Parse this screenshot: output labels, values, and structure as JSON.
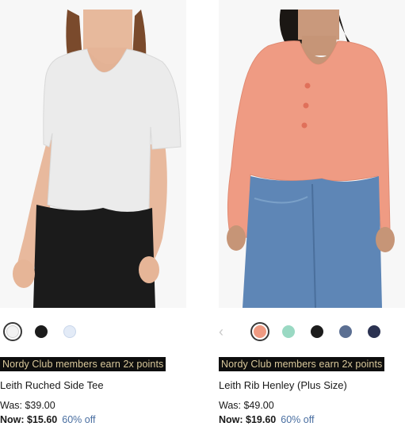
{
  "products": [
    {
      "image_alt": "Woman wearing white V-neck ruched side tee with black skirt",
      "swatches": [
        {
          "name": "White",
          "color": "#f2f2f2",
          "selected": true
        },
        {
          "name": "Black",
          "color": "#1c1c1c",
          "selected": false
        },
        {
          "name": "Light Blue",
          "color": "#e3ebf7",
          "selected": false
        }
      ],
      "badge": "Nordy Club members earn 2x points",
      "name": "Leith Ruched Side Tee",
      "was_label": "Was: $39.00",
      "now_label": "Now: $15.60",
      "discount": "60% off"
    },
    {
      "image_alt": "Woman wearing coral rib henley sweater with blue jeans",
      "has_prev_arrow": true,
      "prev_arrow_icon": "chevron-left-icon",
      "swatches": [
        {
          "name": "Coral",
          "color": "#ef9a82",
          "selected": true
        },
        {
          "name": "Mint",
          "color": "#9ad9c3",
          "selected": false
        },
        {
          "name": "Black",
          "color": "#1c1c1c",
          "selected": false
        },
        {
          "name": "Slate Blue",
          "color": "#5b6f92",
          "selected": false
        },
        {
          "name": "Navy",
          "color": "#2b3251",
          "selected": false
        }
      ],
      "badge": "Nordy Club members earn 2x points",
      "name": "Leith Rib Henley (Plus Size)",
      "was_label": "Was: $49.00",
      "now_label": "Now: $19.60",
      "discount": "60% off"
    }
  ],
  "colors": {
    "badge_bg": "#0e0e0e",
    "badge_text": "#d9c89b",
    "discount": "#4a6fa1"
  }
}
